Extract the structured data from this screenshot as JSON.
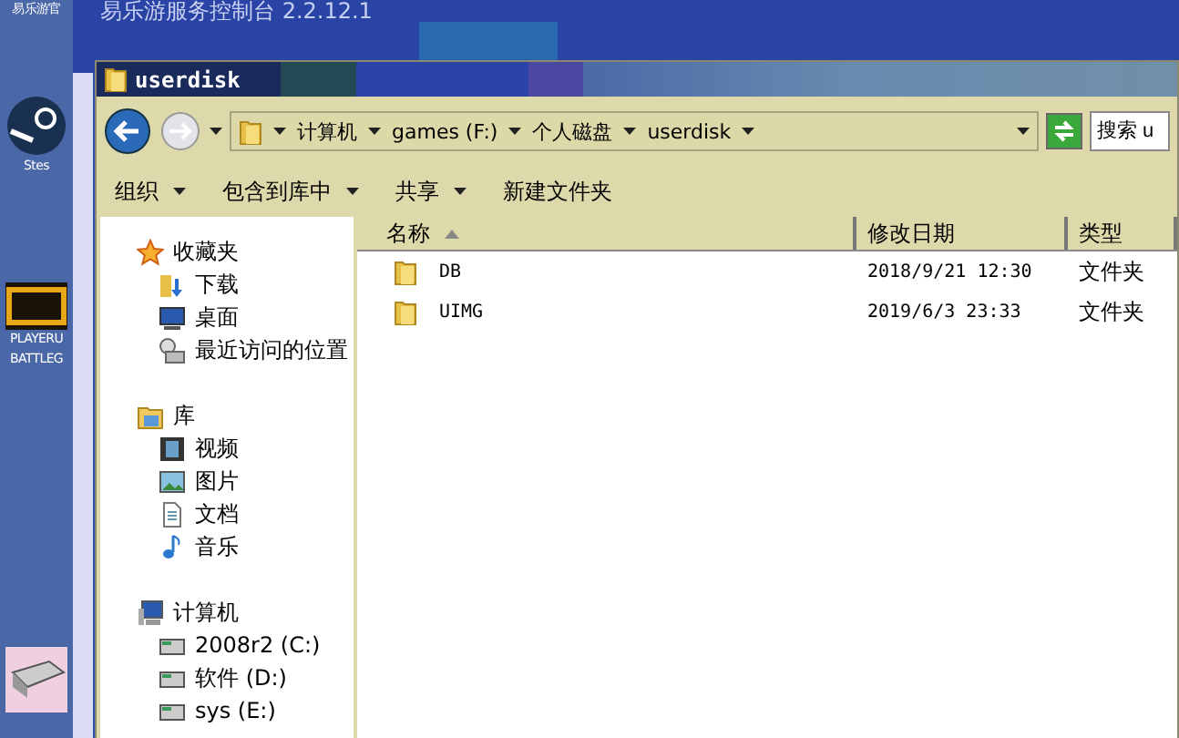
{
  "desktop": {
    "icons": [
      {
        "kind": "app",
        "label": "易乐游官"
      },
      {
        "kind": "steam",
        "label": "Stes"
      },
      {
        "kind": "game",
        "label": "PLAYERU BATTLEG"
      },
      {
        "kind": "drive"
      }
    ]
  },
  "background_window": {
    "title": "易乐游服务控制台 2.2.12.1"
  },
  "explorer": {
    "title": "userdisk",
    "breadcrumb": [
      "计算机",
      "games (F:)",
      "个人磁盘",
      "userdisk"
    ],
    "search": {
      "placeholder": "搜索 u"
    },
    "toolbar": [
      {
        "label": "组织",
        "dropdown": true
      },
      {
        "label": "包含到库中",
        "dropdown": true
      },
      {
        "label": "共享",
        "dropdown": true
      },
      {
        "label": "新建文件夹",
        "dropdown": false
      }
    ],
    "nav": [
      {
        "label": "收藏夹",
        "children": [
          {
            "label": "下载"
          },
          {
            "label": "桌面"
          },
          {
            "label": "最近访问的位置"
          }
        ]
      },
      {
        "label": "库",
        "children": [
          {
            "label": "视频"
          },
          {
            "label": "图片"
          },
          {
            "label": "文档"
          },
          {
            "label": "音乐"
          }
        ]
      },
      {
        "label": "计算机",
        "children": [
          {
            "label": "2008r2 (C:)"
          },
          {
            "label": "软件 (D:)"
          },
          {
            "label": "sys (E:)"
          }
        ]
      }
    ],
    "columns": [
      {
        "label": "名称",
        "sorted": true
      },
      {
        "label": "修改日期",
        "sorted": false
      },
      {
        "label": "类型",
        "sorted": false
      }
    ],
    "rows": [
      {
        "name": "DB",
        "date": "2018/9/21 12:30",
        "type": "文件夹"
      },
      {
        "name": "UIMG",
        "date": "2019/6/3 23:33",
        "type": "文件夹"
      }
    ]
  }
}
